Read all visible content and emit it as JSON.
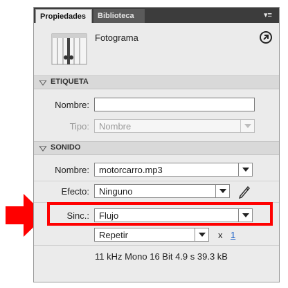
{
  "tabs": [
    {
      "label": "Propiedades",
      "active": true
    },
    {
      "label": "Biblioteca",
      "active": false
    }
  ],
  "tab_menu_icon": "panel-menu-icon",
  "header": {
    "title": "Fotograma",
    "symbol_icon": "frame-thumbnail-icon",
    "help_icon": "help-icon"
  },
  "sections": {
    "etiqueta": {
      "label": "ETIQUETA",
      "nombre_label": "Nombre:",
      "nombre_value": "",
      "tipo_label": "Tipo:",
      "tipo_value": "Nombre"
    },
    "sonido": {
      "label": "SONIDO",
      "nombre_label": "Nombre:",
      "nombre_value": "motorcarro.mp3",
      "efecto_label": "Efecto:",
      "efecto_value": "Ninguno",
      "sinc_label": "Sinc.:",
      "sinc_value": "Flujo",
      "repeat_value": "Repetir",
      "times_label": "x",
      "times_value": "1",
      "info": "11 kHz Mono 16 Bit 4.9 s 39.3 kB"
    }
  },
  "colors": {
    "annotation": "#ff0000",
    "panel_bg": "#ebebeb",
    "tabbar_bg": "#3c3c3c",
    "link": "#1a5fc7"
  }
}
